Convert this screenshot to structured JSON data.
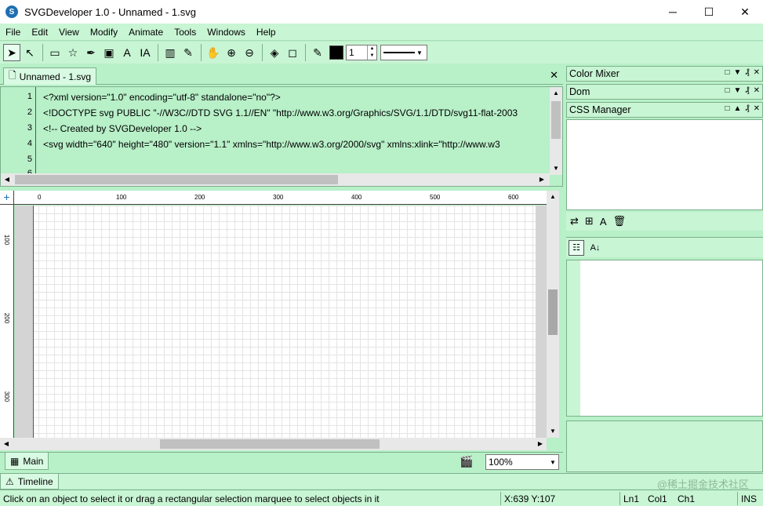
{
  "window": {
    "title": "SVGDeveloper 1.0 - Unnamed - 1.svg",
    "app_icon_letter": "S",
    "controls": [
      "─",
      "☐",
      "✕"
    ]
  },
  "menu": [
    "File",
    "Edit",
    "View",
    "Modify",
    "Animate",
    "Tools",
    "Windows",
    "Help"
  ],
  "toolbar": {
    "tools": [
      {
        "name": "select-arrow-icon",
        "glyph": "➤",
        "active": true
      },
      {
        "name": "direct-select-icon",
        "glyph": "↖"
      },
      {
        "name": "rectangle-tool-icon",
        "glyph": "▭"
      },
      {
        "name": "star-tool-icon",
        "glyph": "☆"
      },
      {
        "name": "pen-tool-icon",
        "glyph": "✒"
      },
      {
        "name": "image-tool-icon",
        "glyph": "▣"
      },
      {
        "name": "text-tool-icon",
        "glyph": "A"
      },
      {
        "name": "text-path-tool-icon",
        "glyph": "IA"
      },
      {
        "name": "gradient-tool-icon",
        "glyph": "▥"
      },
      {
        "name": "eyedropper-icon",
        "glyph": "✎"
      },
      {
        "name": "hand-tool-icon",
        "glyph": "✋"
      },
      {
        "name": "zoom-in-icon",
        "glyph": "⊕"
      },
      {
        "name": "zoom-out-icon",
        "glyph": "⊖"
      },
      {
        "name": "fill-tool-icon",
        "glyph": "◈"
      },
      {
        "name": "fill-color-icon",
        "glyph": "◻"
      }
    ],
    "stroke_width": "1",
    "stroke_color": "#000000"
  },
  "document": {
    "tab_label": "Unnamed - 1.svg",
    "line_numbers": [
      "1",
      "2",
      "3",
      "4",
      "5",
      "6"
    ],
    "code_lines": [
      "<?xml version=\"1.0\" encoding=\"utf-8\" standalone=\"no\"?>",
      "<!DOCTYPE svg PUBLIC \"-//W3C//DTD SVG 1.1//EN\" \"http://www.w3.org/Graphics/SVG/1.1/DTD/svg11-flat-2003",
      "<!-- Created by SVGDeveloper 1.0 -->",
      "<svg width=\"640\" height=\"480\" version=\"1.1\" xmlns=\"http://www.w3.org/2000/svg\" xmlns:xlink=\"http://www.w3",
      "",
      ""
    ]
  },
  "rulers": {
    "top_labels": [
      "0",
      "100",
      "200",
      "300",
      "400",
      "500",
      "600"
    ],
    "left_labels": [
      "100",
      "200",
      "300"
    ]
  },
  "bottom": {
    "main_tab": "Main",
    "zoom": "100%",
    "timeline_tab": "Timeline",
    "watermark": "@稀土掘金技术社区"
  },
  "status": {
    "message": "Click on an object to select it or drag a rectangular selection marquee to select objects in it",
    "coords": "X:639  Y:107",
    "line": "Ln1",
    "col": "Col1",
    "ch": "Ch1",
    "mode": "INS"
  },
  "panels": {
    "color_mixer": "Color Mixer",
    "dom": "Dom",
    "css_manager": "CSS Manager"
  },
  "colors": {
    "panel_bg": "#b8f0c8",
    "title_bg": "#ffffff"
  }
}
